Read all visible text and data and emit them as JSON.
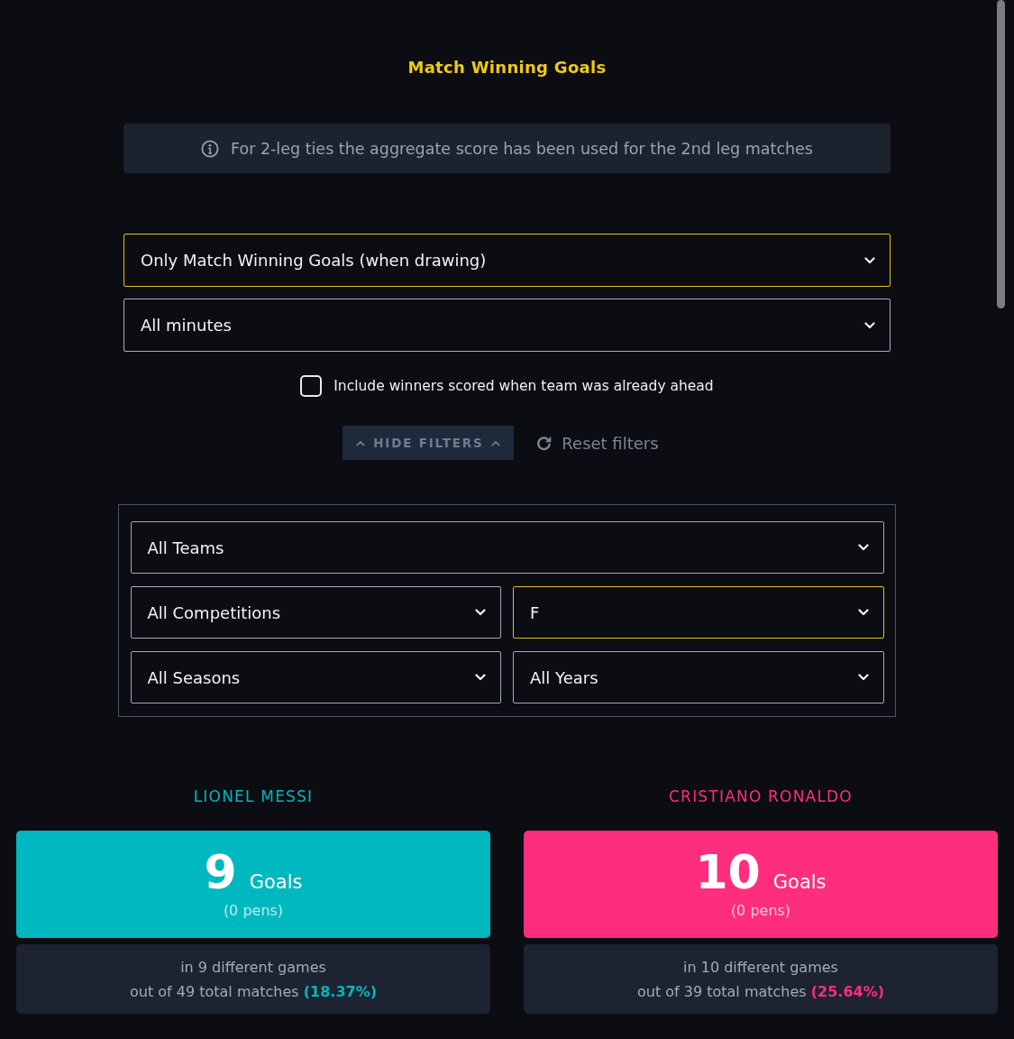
{
  "title": "Match Winning Goals",
  "notice": {
    "text": "For 2-leg ties the aggregate score has been used for the 2nd leg matches"
  },
  "main_filters": [
    {
      "value": "Only Match Winning Goals (when drawing)",
      "active": true
    },
    {
      "value": "All minutes",
      "active": false
    }
  ],
  "include_checkbox": {
    "label": "Include winners scored when team was already ahead",
    "checked": false
  },
  "hide_filters_button": "HIDE FILTERS",
  "reset_button": "Reset filters",
  "filter_panel": {
    "rows": [
      {
        "selects": [
          {
            "value": "All Teams",
            "active": false
          }
        ]
      },
      {
        "selects": [
          {
            "value": "All Competitions",
            "active": false
          },
          {
            "value": "F",
            "active": true
          }
        ]
      },
      {
        "selects": [
          {
            "value": "All Seasons",
            "active": false
          },
          {
            "value": "All Years",
            "active": false
          }
        ]
      }
    ]
  },
  "players": [
    {
      "name": "LIONEL MESSI",
      "color": "#00b8bf",
      "goals": "9",
      "goals_label": "Goals",
      "pens": "(0 pens)",
      "games": "in 9 different games",
      "matches": "out of 49 total matches **(18.37%)**"
    },
    {
      "name": "CRISTIANO RONALDO",
      "color": "#ff2d7e",
      "goals": "10",
      "goals_label": "Goals",
      "pens": "(0 pens)",
      "games": "in 10 different games",
      "matches": "out of 39 total matches **(25.64%)**"
    }
  ]
}
